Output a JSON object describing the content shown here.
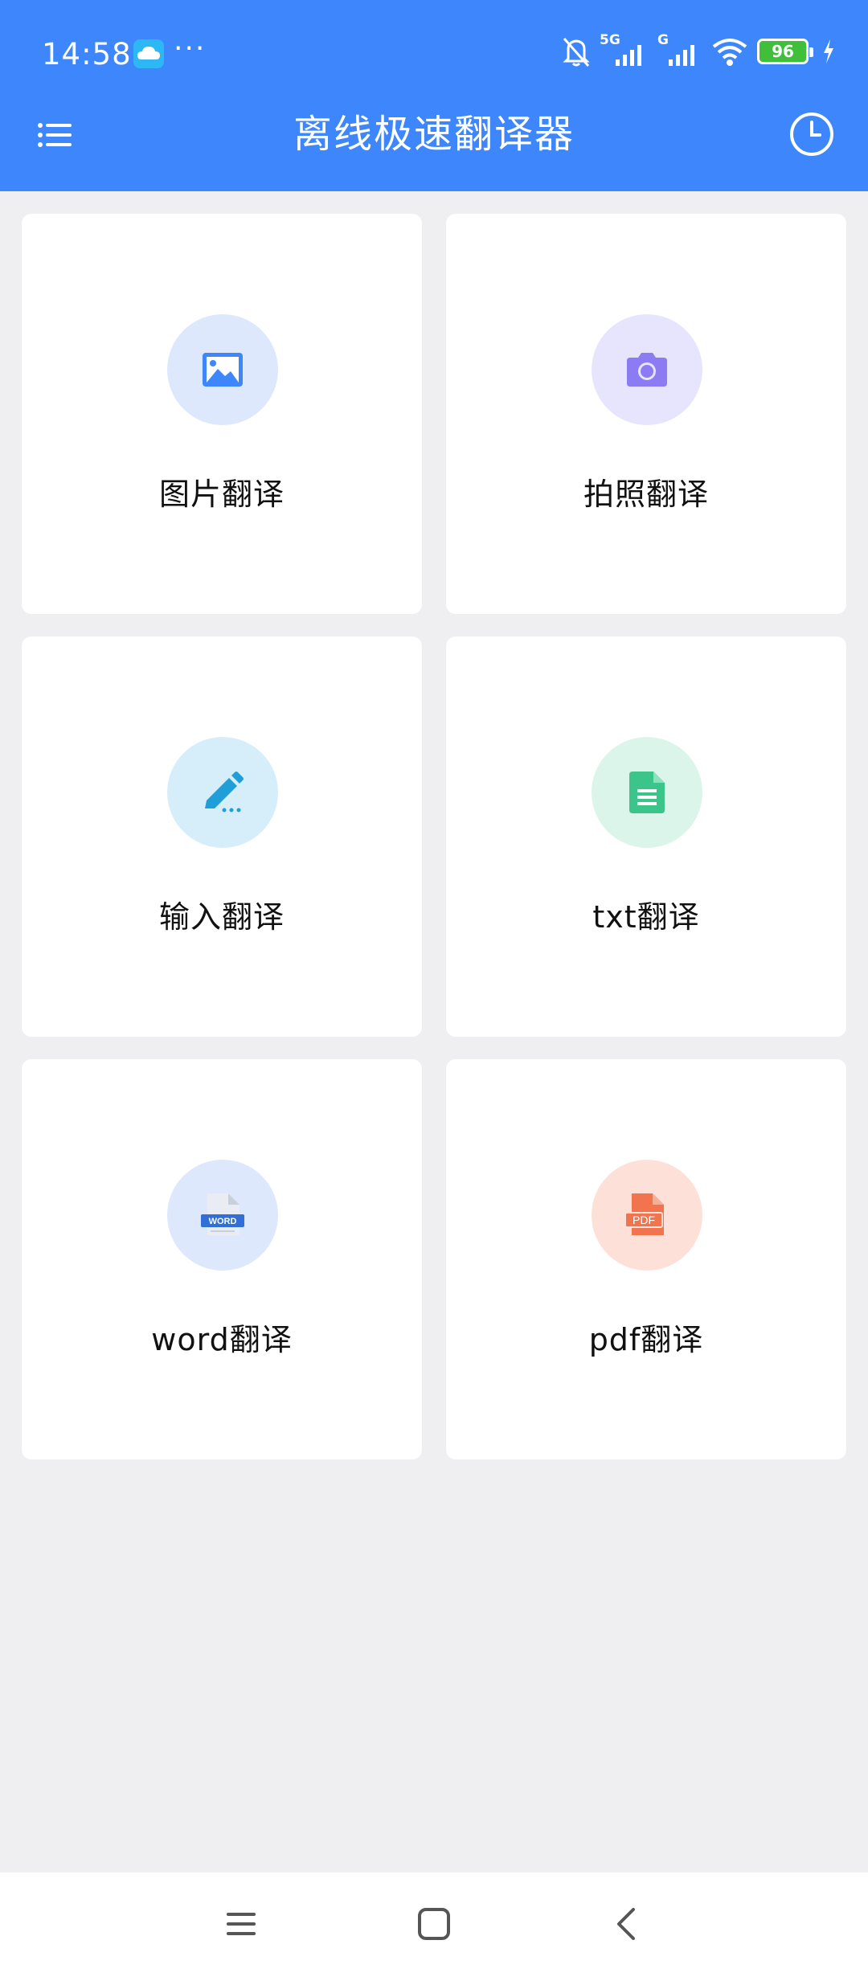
{
  "status": {
    "time": "14:58",
    "more": "···",
    "network_1": "5G",
    "network_2": "G",
    "battery": "96"
  },
  "header": {
    "title": "离线极速翻译器"
  },
  "cards": [
    {
      "label": "图片翻译",
      "icon": "image-icon",
      "bg": "#dde8fd",
      "fg": "#3d86fc"
    },
    {
      "label": "拍照翻译",
      "icon": "camera-icon",
      "bg": "#e7e4fd",
      "fg": "#8a7df4"
    },
    {
      "label": "输入翻译",
      "icon": "pencil-icon",
      "bg": "#d5eefa",
      "fg": "#1f9ed8"
    },
    {
      "label": "txt翻译",
      "icon": "document-icon",
      "bg": "#dbf5ea",
      "fg": "#3cc58a"
    },
    {
      "label": "word翻译",
      "icon": "word-file-icon",
      "bg": "#dde8fd",
      "fg": "#2f6fd6"
    },
    {
      "label": "pdf翻译",
      "icon": "pdf-file-icon",
      "bg": "#fde1d8",
      "fg": "#f1744f"
    }
  ],
  "colors": {
    "accent": "#3d86fc",
    "background": "#efeff1",
    "card": "#ffffff"
  },
  "icons": {
    "word_text": "WORD",
    "pdf_text": "PDF"
  }
}
